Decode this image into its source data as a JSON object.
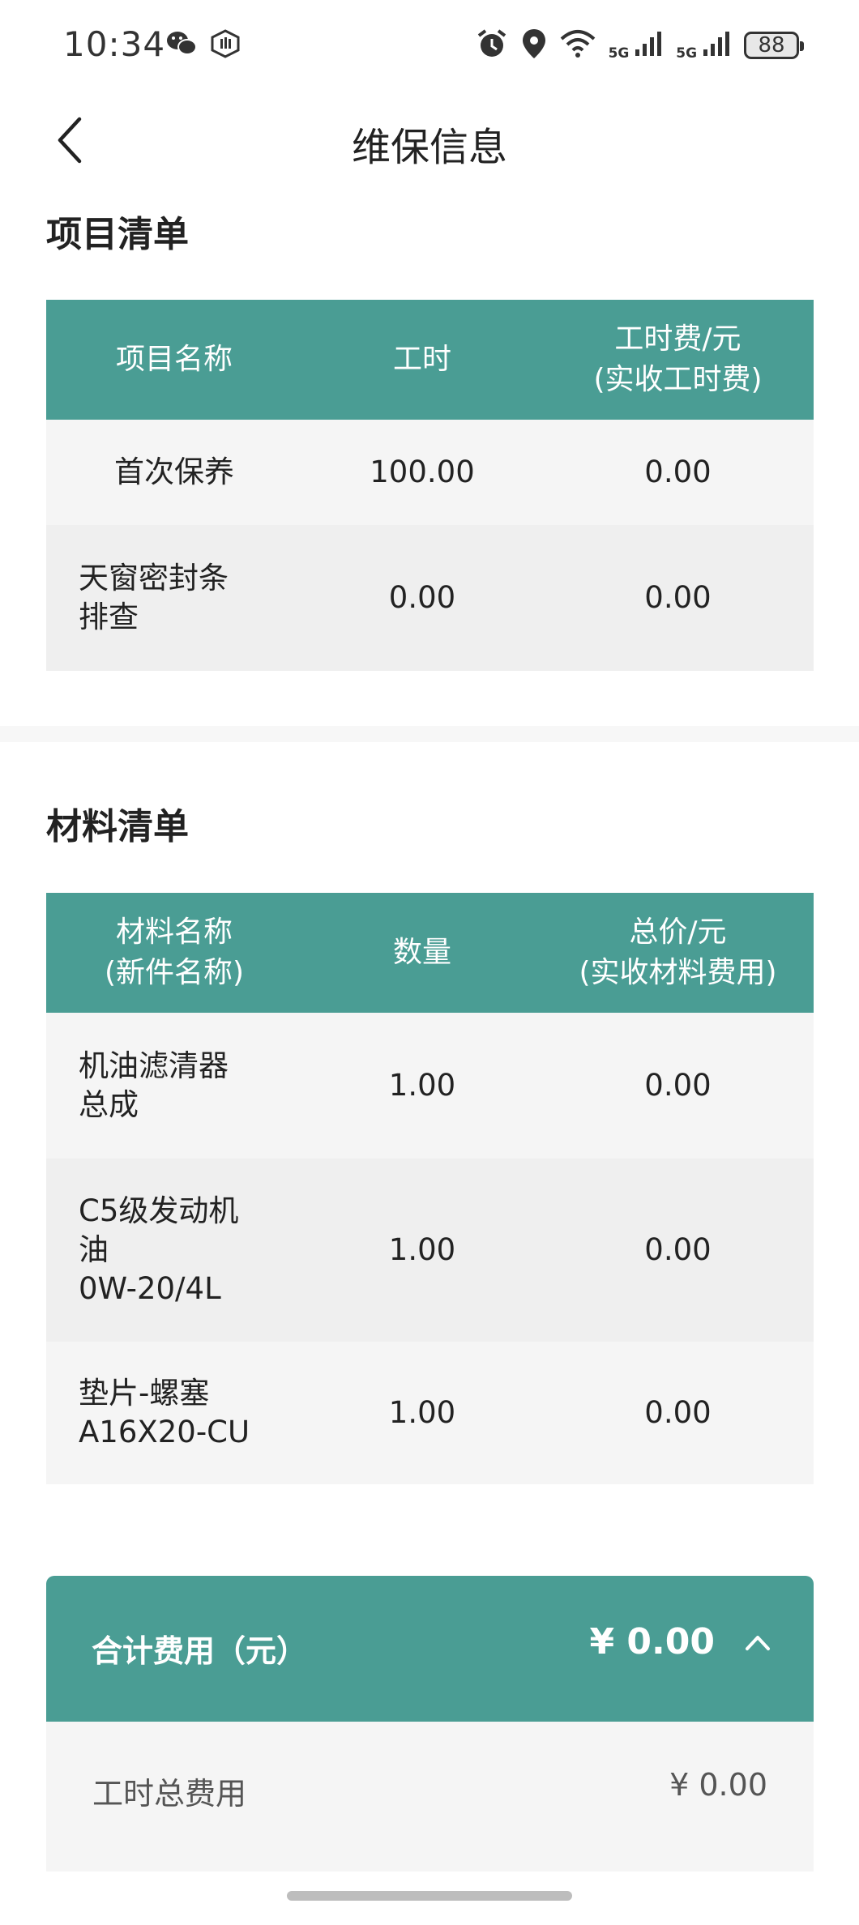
{
  "status_bar": {
    "time": "10:34",
    "net1": "5G",
    "net2": "5G",
    "battery": "88",
    "icons": [
      "wechat-icon",
      "shield-hand-icon",
      "alarm-icon",
      "location-icon",
      "wifi-icon",
      "signal-icon",
      "signal-icon"
    ]
  },
  "header": {
    "title": "维保信息",
    "back_icon": "chevron-left-icon"
  },
  "project_list": {
    "title": "项目清单",
    "columns": [
      "项目名称",
      "工时",
      "工时费/元\n(实收工时费)"
    ],
    "rows": [
      {
        "name": "首次保养",
        "hours": "100.00",
        "fee": "0.00"
      },
      {
        "name": "天窗密封条\n排查",
        "hours": "0.00",
        "fee": "0.00"
      }
    ]
  },
  "material_list": {
    "title": "材料清单",
    "columns": [
      "材料名称\n(新件名称)",
      "数量",
      "总价/元\n(实收材料费用)"
    ],
    "rows": [
      {
        "name": "机油滤清器\n总成",
        "qty": "1.00",
        "price": "0.00"
      },
      {
        "name": "C5级发动机\n油\n0W-20/4L",
        "qty": "1.00",
        "price": "0.00"
      },
      {
        "name": "垫片-螺塞\nA16X20-CU",
        "qty": "1.00",
        "price": "0.00"
      }
    ]
  },
  "summary": {
    "label": "合计费用（元）",
    "total": "¥ 0.00",
    "chevron_icon": "chevron-up-icon",
    "rows": [
      {
        "label": "工时总费用",
        "value": "¥ 0.00"
      }
    ]
  },
  "colors": {
    "accent": "#4a9d94",
    "row_light": "#f5f5f5",
    "row_dark": "#efefef"
  }
}
